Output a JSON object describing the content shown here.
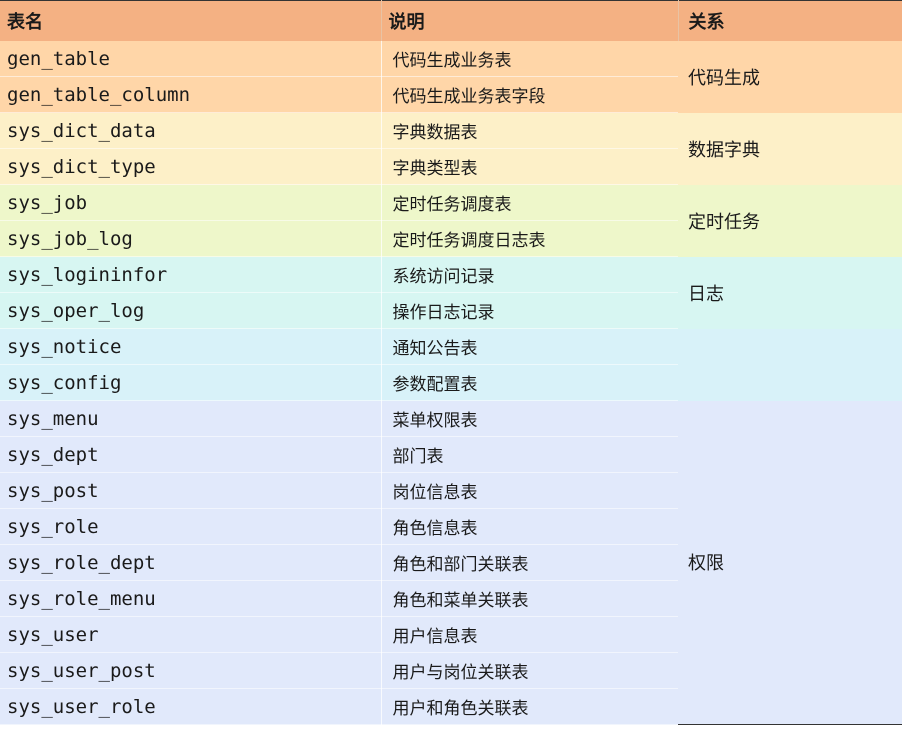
{
  "header": {
    "col_name": "表名",
    "col_desc": "说明",
    "col_rel": "关系"
  },
  "groups": [
    {
      "relation": "代码生成",
      "color": "#ffd6a8",
      "rows": [
        {
          "name": "gen_table",
          "desc": "代码生成业务表"
        },
        {
          "name": "gen_table_column",
          "desc": "代码生成业务表字段"
        }
      ]
    },
    {
      "relation": "数据字典",
      "color": "#fdf0c8",
      "rows": [
        {
          "name": "sys_dict_data",
          "desc": "字典数据表"
        },
        {
          "name": "sys_dict_type",
          "desc": "字典类型表"
        }
      ]
    },
    {
      "relation": "定时任务",
      "color": "#eef7ca",
      "rows": [
        {
          "name": "sys_job",
          "desc": "定时任务调度表"
        },
        {
          "name": "sys_job_log",
          "desc": "定时任务调度日志表"
        }
      ]
    },
    {
      "relation": "日志",
      "color": "#d7f6f2",
      "rows": [
        {
          "name": "sys_logininfor",
          "desc": "系统访问记录"
        },
        {
          "name": "sys_oper_log",
          "desc": "操作日志记录"
        }
      ]
    },
    {
      "relation": "",
      "color": "#d8f2f9",
      "rows": [
        {
          "name": "sys_notice",
          "desc": "通知公告表"
        },
        {
          "name": "sys_config",
          "desc": "参数配置表"
        }
      ]
    },
    {
      "relation": "权限",
      "color": "#e1e9fb",
      "rows": [
        {
          "name": "sys_menu",
          "desc": "菜单权限表"
        },
        {
          "name": "sys_dept",
          "desc": "部门表"
        },
        {
          "name": "sys_post",
          "desc": "岗位信息表"
        },
        {
          "name": "sys_role",
          "desc": "角色信息表"
        },
        {
          "name": "sys_role_dept",
          "desc": "角色和部门关联表"
        },
        {
          "name": "sys_role_menu",
          "desc": "角色和菜单关联表"
        },
        {
          "name": "sys_user",
          "desc": "用户信息表"
        },
        {
          "name": "sys_user_post",
          "desc": "用户与岗位关联表"
        },
        {
          "name": "sys_user_role",
          "desc": "用户和角色关联表"
        }
      ]
    }
  ]
}
